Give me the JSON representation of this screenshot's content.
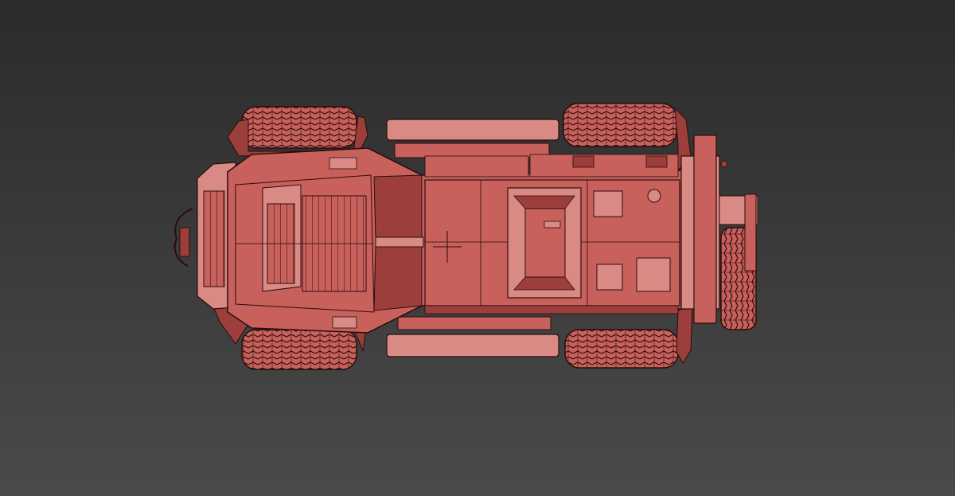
{
  "viewport": {
    "view": "top",
    "shading": "wireframe-on-shaded",
    "background": {
      "top": "#2b2b2b",
      "bottom": "#4a4a4a"
    }
  },
  "model": {
    "subject": "armored-vehicle",
    "color": "#c8605c",
    "color_dark": "#9c3f3c",
    "color_light": "#d98a85",
    "edge_color": "#2a0d0c",
    "wheel_count": 5
  }
}
